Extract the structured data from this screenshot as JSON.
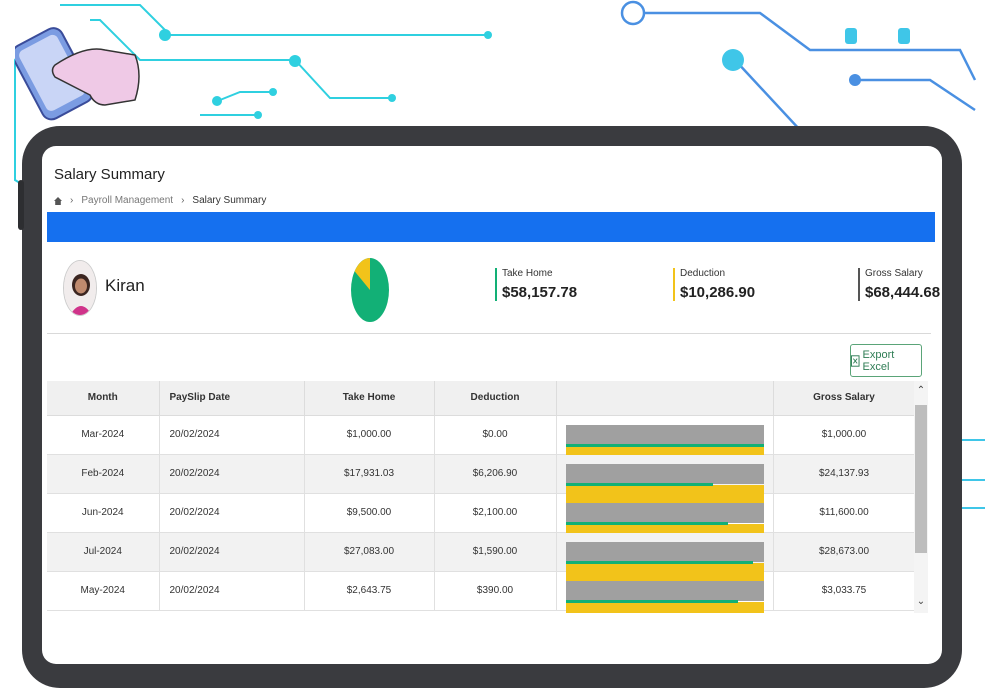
{
  "page": {
    "title": "Salary Summary"
  },
  "breadcrumb": {
    "items": [
      "Payroll Management",
      "Salary Summary"
    ]
  },
  "employee": {
    "name": "Kiran"
  },
  "summary": {
    "pie_take_home_fraction": 0.85,
    "take_home": {
      "label": "Take Home",
      "value": "$58,157.78"
    },
    "deduction": {
      "label": "Deduction",
      "value": "$10,286.90"
    },
    "gross": {
      "label": "Gross Salary",
      "value": "$68,444.68"
    }
  },
  "toolbar": {
    "export_label": "Export Excel"
  },
  "table": {
    "headers": [
      "Month",
      "PaySlip Date",
      "Take Home",
      "Deduction",
      "",
      "Gross Salary"
    ],
    "rows": [
      {
        "month": "Mar-2024",
        "date": "20/02/2024",
        "take_home": "$1,000.00",
        "deduction": "$0.00",
        "gross": "$1,000.00",
        "take_frac": 1.0
      },
      {
        "month": "Feb-2024",
        "date": "20/02/2024",
        "take_home": "$17,931.03",
        "deduction": "$6,206.90",
        "gross": "$24,137.93",
        "take_frac": 0.743
      },
      {
        "month": "Jun-2024",
        "date": "20/02/2024",
        "take_home": "$9,500.00",
        "deduction": "$2,100.00",
        "gross": "$11,600.00",
        "take_frac": 0.819
      },
      {
        "month": "Jul-2024",
        "date": "20/02/2024",
        "take_home": "$27,083.00",
        "deduction": "$1,590.00",
        "gross": "$28,673.00",
        "take_frac": 0.945
      },
      {
        "month": "May-2024",
        "date": "20/02/2024",
        "take_home": "$2,643.75",
        "deduction": "$390.00",
        "gross": "$3,033.75",
        "take_frac": 0.871
      }
    ]
  },
  "colors": {
    "accent_blue": "#1570ef",
    "take_home_green": "#12b076",
    "deduction_yellow": "#f2c31a",
    "gross_gray": "#a0a0a0"
  }
}
